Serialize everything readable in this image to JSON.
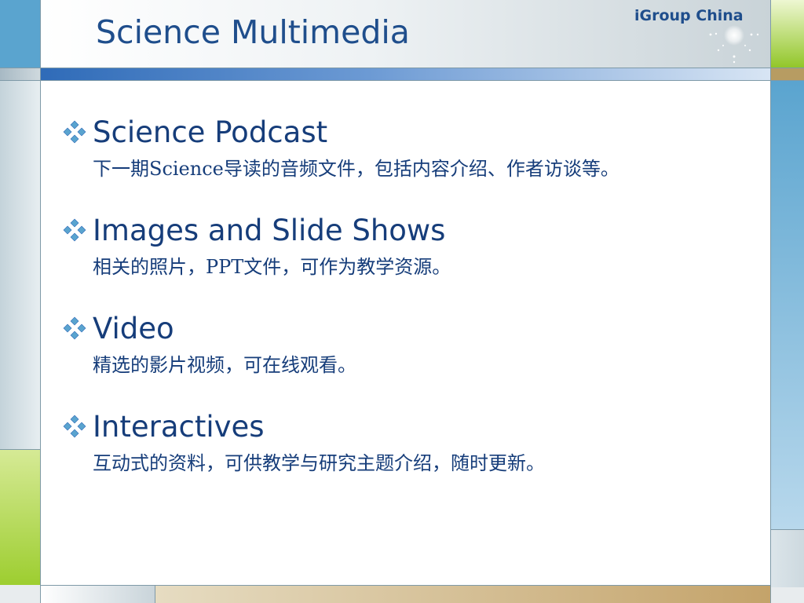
{
  "slide": {
    "title": "Science Multimedia",
    "brand": "iGroup China"
  },
  "items": [
    {
      "label": "Science Podcast",
      "description": "下一期Science导读的音频文件，包括内容介绍、作者访谈等。"
    },
    {
      "label": "Images and Slide Shows",
      "description": "相关的照片，PPT文件，可作为教学资源。"
    },
    {
      "label": "Video",
      "description": "精选的影片视频，可在线观看。"
    },
    {
      "label": "Interactives",
      "description": "互动式的资料，可供教学与研究主题介绍，随时更新。"
    }
  ],
  "colors": {
    "title": "#1f4e8c",
    "text": "#163d7a",
    "bullet": "#5aa4cf",
    "accent_green": "#9ccd2e",
    "accent_blue": "#2f6bb8"
  },
  "icons": {
    "bullet": "four-diamond-bullet-icon",
    "logo": "sparkle-star-icon"
  }
}
